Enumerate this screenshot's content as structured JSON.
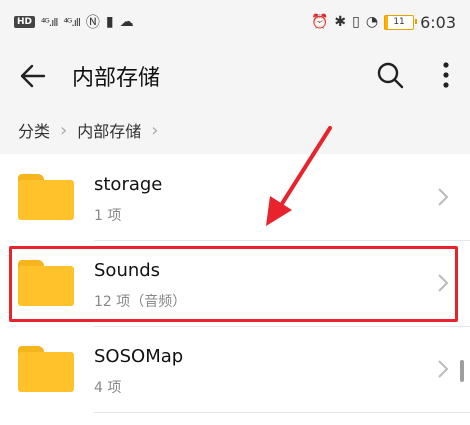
{
  "status_bar": {
    "left_chip": "HD",
    "signal_1": "⁴ᴳ.ıll",
    "signal_2": "⁴ᴳ.ıll",
    "battery_level": "11",
    "time": "6:03"
  },
  "header": {
    "title": "内部存储"
  },
  "breadcrumb": {
    "items": [
      "分类",
      "内部存储"
    ]
  },
  "files": [
    {
      "name": "storage",
      "meta": "1 项"
    },
    {
      "name": "Sounds",
      "meta": "12 项（音频）"
    },
    {
      "name": "SOSOMap",
      "meta": "4 项"
    }
  ],
  "colors": {
    "folder": "#ffc22b",
    "highlight": "#e8232b",
    "arrow": "#e8232b"
  }
}
